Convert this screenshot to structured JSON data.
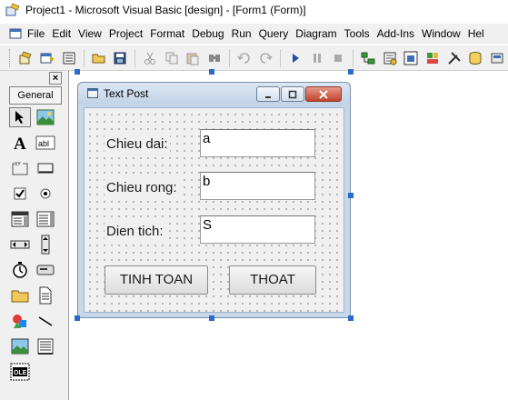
{
  "window": {
    "title": "Project1 - Microsoft Visual Basic [design] - [Form1 (Form)]"
  },
  "menu": [
    "File",
    "Edit",
    "View",
    "Project",
    "Format",
    "Debug",
    "Run",
    "Query",
    "Diagram",
    "Tools",
    "Add-Ins",
    "Window",
    "Hel"
  ],
  "toolbar": {
    "buttons": [
      "add-project-icon",
      "add-form-icon",
      "menu-editor-icon",
      "open-project-icon",
      "save-project-icon",
      "cut-icon",
      "copy-icon",
      "paste-icon",
      "find-icon",
      "undo-icon",
      "redo-icon",
      "start-icon",
      "break-icon",
      "end-icon",
      "project-explorer-icon",
      "properties-window-icon",
      "form-layout-icon",
      "object-browser-icon",
      "toolbox-icon",
      "data-view-icon",
      "component-manager-icon"
    ]
  },
  "toolbox": {
    "close_label": "×",
    "tab_label": "General",
    "tools": [
      "pointer",
      "picturebox",
      "label",
      "textbox",
      "frame",
      "commandbutton",
      "checkbox",
      "optionbutton",
      "combobox",
      "listbox",
      "hscrollbar",
      "vscrollbar",
      "timer",
      "drivelistbox",
      "dirlistbox",
      "filelistbox",
      "shape",
      "line",
      "image",
      "data",
      "ole"
    ],
    "ole_label": "OLE"
  },
  "form": {
    "title": "Text Post",
    "labels": {
      "length": "Chieu dai:",
      "width": "Chieu rong:",
      "area": "Dien tich:"
    },
    "textboxes": {
      "a": "a",
      "b": "b",
      "s": "S"
    },
    "buttons": {
      "calculate": "TINH TOAN",
      "exit": "THOAT"
    }
  },
  "colors": {
    "selection_handle": "#2a6acb",
    "form_frame": "#c7d7ea",
    "close_button": "#c2432b"
  }
}
